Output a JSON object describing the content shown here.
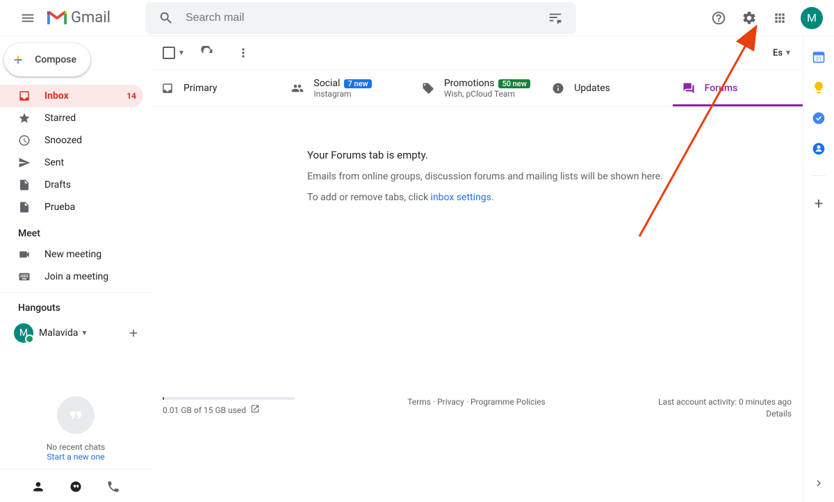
{
  "header": {
    "app_name": "Gmail",
    "search_placeholder": "Search mail",
    "avatar_initial": "M"
  },
  "compose_label": "Compose",
  "nav": [
    {
      "icon": "inbox",
      "label": "Inbox",
      "count": "14",
      "active": true
    },
    {
      "icon": "star",
      "label": "Starred"
    },
    {
      "icon": "clock",
      "label": "Snoozed"
    },
    {
      "icon": "send",
      "label": "Sent"
    },
    {
      "icon": "file",
      "label": "Drafts"
    },
    {
      "icon": "file",
      "label": "Prueba"
    }
  ],
  "meet": {
    "section": "Meet",
    "items": [
      {
        "icon": "video",
        "label": "New meeting"
      },
      {
        "icon": "keyboard",
        "label": "Join a meeting"
      }
    ]
  },
  "hangouts": {
    "section": "Hangouts",
    "user": "Malavida",
    "avatar_initial": "M",
    "no_chats": "No recent chats",
    "start": "Start a new one"
  },
  "toolbar": {
    "language": "Es"
  },
  "tabs": [
    {
      "id": "primary",
      "label": "Primary"
    },
    {
      "id": "social",
      "label": "Social",
      "badge": "7 new",
      "badge_color": "blue",
      "sub": "Instagram"
    },
    {
      "id": "promotions",
      "label": "Promotions",
      "badge": "50 new",
      "badge_color": "green",
      "sub": "Wish, pCloud Team"
    },
    {
      "id": "updates",
      "label": "Updates"
    },
    {
      "id": "forums",
      "label": "Forums",
      "active": true
    }
  ],
  "empty": {
    "line1": "Your Forums tab is empty.",
    "line2": "Emails from online groups, discussion forums and mailing lists will be shown here.",
    "line3_prefix": "To add or remove tabs, click ",
    "line3_link": "inbox settings",
    "line3_suffix": "."
  },
  "footer": {
    "storage": "0.01 GB of 15 GB used",
    "terms": "Terms",
    "privacy": "Privacy",
    "policies": "Programme Policies",
    "sep": " · ",
    "activity": "Last account activity: 0 minutes ago",
    "details": "Details"
  }
}
